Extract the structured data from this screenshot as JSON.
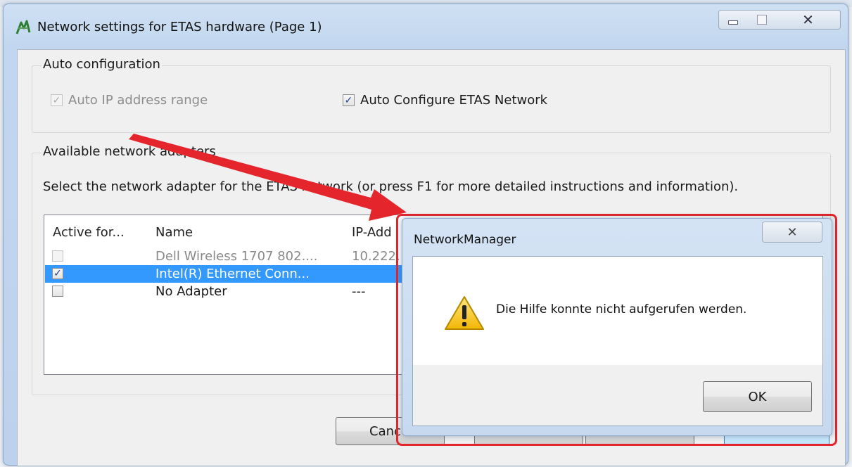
{
  "window": {
    "title": "Network settings for ETAS hardware (Page 1)",
    "close_glyph": "✕"
  },
  "auto_config": {
    "group_label": "Auto configuration",
    "auto_ip_label": "Auto IP address range",
    "auto_ip_checked": true,
    "auto_configure_label": "Auto Configure ETAS Network",
    "auto_configure_checked": true
  },
  "adapters": {
    "group_label": "Available network adapters",
    "instruction": "Select the network adapter for the ETAS network (or press F1 for more detailed instructions and information).",
    "columns": [
      "Active for...",
      "Name",
      "IP-Add"
    ],
    "rows": [
      {
        "checked": false,
        "name": "Dell Wireless 1707 802....",
        "ip": "10.222.",
        "state": "disabled"
      },
      {
        "checked": true,
        "name": "Intel(R) Ethernet Conn...",
        "ip": "",
        "state": "selected"
      },
      {
        "checked": false,
        "name": "No Adapter",
        "ip": "---",
        "state": "normal"
      }
    ]
  },
  "footer": {
    "cancel_label": "Canc"
  },
  "message_box": {
    "title": "NetworkManager",
    "text": "Die Hilfe konnte nicht aufgerufen werden.",
    "ok_label": "OK",
    "close_glyph": "✕",
    "icon": "warning-icon"
  },
  "colors": {
    "highlight": "#e4262c",
    "selection": "#3399ff"
  }
}
